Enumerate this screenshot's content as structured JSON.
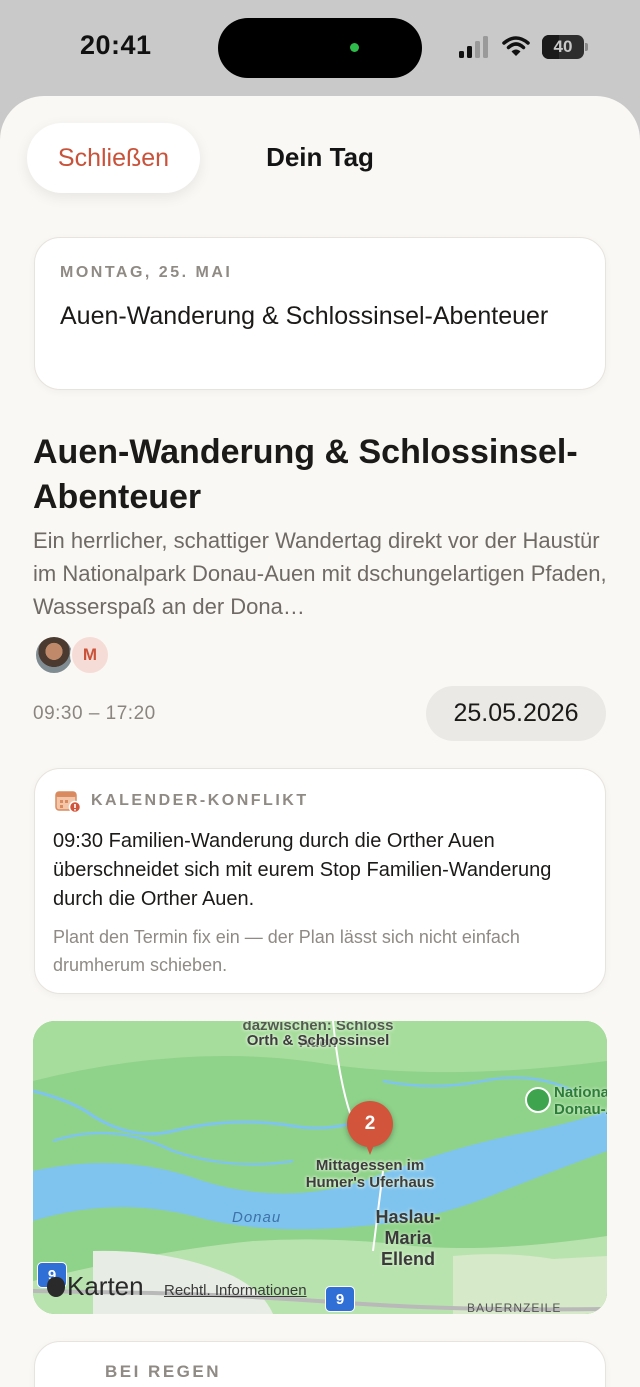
{
  "status_bar": {
    "time": "20:41",
    "battery": "40",
    "battery_level_percent": 40
  },
  "nav": {
    "close_label": "Schließen",
    "title": "Dein Tag"
  },
  "day_card": {
    "date": "MONTAG, 25. MAI",
    "title": "Auen-Wanderung & Schlossinsel-Abenteuer"
  },
  "plan": {
    "title": "Auen-Wanderung & Schlossinsel-Abenteuer",
    "description": "Ein herrlicher, schattiger Wandertag direkt vor der Haustür im Nationalpark Donau-Auen mit dschungelartigen Pfaden, Wasserspaß an der Dona…",
    "participants": [
      {
        "type": "photo",
        "icon": "user-photo-avatar"
      },
      {
        "type": "initial",
        "initial": "M"
      }
    ],
    "time_range": "09:30 – 17:20",
    "date": "25.05.2026"
  },
  "conflict": {
    "icon": "calendar-warning-icon",
    "eyebrow": "KALENDER-KONFLIKT",
    "message": "09:30 Familien-Wanderung durch die Orther Auen überschneidet sich mit eurem Stop Familien-Wanderung durch die Orther Auen.",
    "note": "Plant den Termin fix ein — der Plan lässt sich nicht einfach drumherum schieben."
  },
  "map": {
    "label_top_overlap": "dazwischen: Schloss Auen",
    "label_top": "Orth & Schlossinsel",
    "pin_number": "2",
    "pin_label": "Mittagessen im Humer's Uferhaus",
    "park_label": "Nationalpark Donau-Auen",
    "river_label": "Donau",
    "town_label": "Haslau-Maria Ellend",
    "road_numbers": [
      "9",
      "9"
    ],
    "road_label": "BAUERNZEILE",
    "maps_brand": "Karten",
    "legal_link": "Rechtl. Informationen",
    "colors": {
      "land": "#8fd28a",
      "river": "#7fc4ef",
      "pin": "#d2553b"
    }
  },
  "rain_card": {
    "eyebrow": "BEI REGEN"
  },
  "colors": {
    "accent": "#c9523a",
    "background": "#faf8f4",
    "muted_text": "#8f8a84"
  }
}
